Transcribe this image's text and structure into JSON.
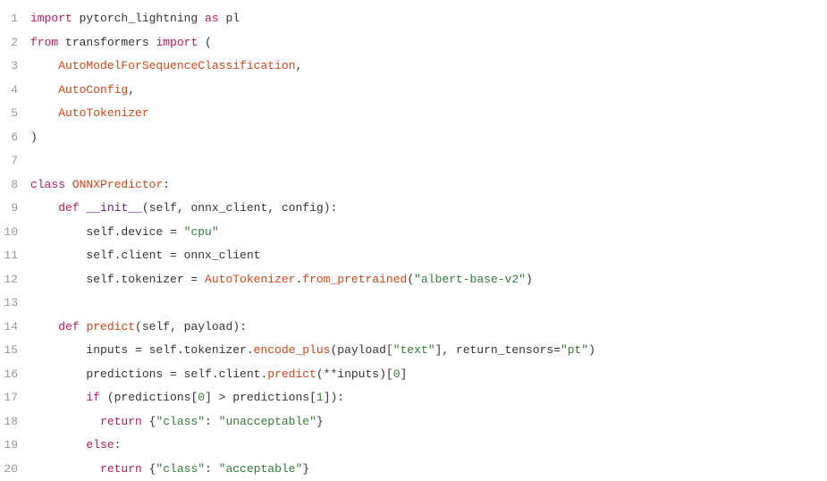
{
  "lines": [
    {
      "num": "1",
      "tokens": [
        {
          "cls": "keyword",
          "text": "import"
        },
        {
          "cls": "",
          "text": " pytorch_lightning "
        },
        {
          "cls": "keyword",
          "text": "as"
        },
        {
          "cls": "",
          "text": " pl"
        }
      ]
    },
    {
      "num": "2",
      "tokens": [
        {
          "cls": "keyword",
          "text": "from"
        },
        {
          "cls": "",
          "text": " transformers "
        },
        {
          "cls": "keyword",
          "text": "import"
        },
        {
          "cls": "",
          "text": " ("
        }
      ]
    },
    {
      "num": "3",
      "tokens": [
        {
          "cls": "",
          "text": "    "
        },
        {
          "cls": "import-name",
          "text": "AutoModelForSequenceClassification"
        },
        {
          "cls": "",
          "text": ","
        }
      ]
    },
    {
      "num": "4",
      "tokens": [
        {
          "cls": "",
          "text": "    "
        },
        {
          "cls": "import-name",
          "text": "AutoConfig"
        },
        {
          "cls": "",
          "text": ","
        }
      ]
    },
    {
      "num": "5",
      "tokens": [
        {
          "cls": "",
          "text": "    "
        },
        {
          "cls": "import-name",
          "text": "AutoTokenizer"
        }
      ]
    },
    {
      "num": "6",
      "tokens": [
        {
          "cls": "",
          "text": ")"
        }
      ]
    },
    {
      "num": "7",
      "tokens": []
    },
    {
      "num": "8",
      "tokens": [
        {
          "cls": "keyword",
          "text": "class"
        },
        {
          "cls": "",
          "text": " "
        },
        {
          "cls": "class-def",
          "text": "ONNXPredictor"
        },
        {
          "cls": "",
          "text": ":"
        }
      ]
    },
    {
      "num": "9",
      "tokens": [
        {
          "cls": "",
          "text": "    "
        },
        {
          "cls": "keyword",
          "text": "def"
        },
        {
          "cls": "",
          "text": " "
        },
        {
          "cls": "dunder",
          "text": "__init__"
        },
        {
          "cls": "",
          "text": "(self, onnx_client, config):"
        }
      ]
    },
    {
      "num": "10",
      "tokens": [
        {
          "cls": "",
          "text": "        self.device = "
        },
        {
          "cls": "string",
          "text": "\"cpu\""
        }
      ]
    },
    {
      "num": "11",
      "tokens": [
        {
          "cls": "",
          "text": "        self.client = onnx_client"
        }
      ]
    },
    {
      "num": "12",
      "tokens": [
        {
          "cls": "",
          "text": "        self.tokenizer = "
        },
        {
          "cls": "method-call",
          "text": "AutoTokenizer"
        },
        {
          "cls": "",
          "text": "."
        },
        {
          "cls": "method-call",
          "text": "from_pretrained"
        },
        {
          "cls": "",
          "text": "("
        },
        {
          "cls": "string",
          "text": "\"albert-base-v2\""
        },
        {
          "cls": "",
          "text": ")"
        }
      ]
    },
    {
      "num": "13",
      "tokens": []
    },
    {
      "num": "14",
      "tokens": [
        {
          "cls": "",
          "text": "    "
        },
        {
          "cls": "keyword",
          "text": "def"
        },
        {
          "cls": "",
          "text": " "
        },
        {
          "cls": "func-def",
          "text": "predict"
        },
        {
          "cls": "",
          "text": "(self, payload):"
        }
      ]
    },
    {
      "num": "15",
      "tokens": [
        {
          "cls": "",
          "text": "        inputs = self.tokenizer."
        },
        {
          "cls": "method-call",
          "text": "encode_plus"
        },
        {
          "cls": "",
          "text": "(payload["
        },
        {
          "cls": "string",
          "text": "\"text\""
        },
        {
          "cls": "",
          "text": "], return_tensors="
        },
        {
          "cls": "string",
          "text": "\"pt\""
        },
        {
          "cls": "",
          "text": ")"
        }
      ]
    },
    {
      "num": "16",
      "tokens": [
        {
          "cls": "",
          "text": "        predictions = self.client."
        },
        {
          "cls": "method-call",
          "text": "predict"
        },
        {
          "cls": "",
          "text": "(**inputs)["
        },
        {
          "cls": "number",
          "text": "0"
        },
        {
          "cls": "",
          "text": "]"
        }
      ]
    },
    {
      "num": "17",
      "tokens": [
        {
          "cls": "",
          "text": "        "
        },
        {
          "cls": "keyword",
          "text": "if"
        },
        {
          "cls": "",
          "text": " (predictions["
        },
        {
          "cls": "number",
          "text": "0"
        },
        {
          "cls": "",
          "text": "] > predictions["
        },
        {
          "cls": "number",
          "text": "1"
        },
        {
          "cls": "",
          "text": "]):"
        }
      ]
    },
    {
      "num": "18",
      "tokens": [
        {
          "cls": "",
          "text": "          "
        },
        {
          "cls": "keyword",
          "text": "return"
        },
        {
          "cls": "",
          "text": " {"
        },
        {
          "cls": "string",
          "text": "\"class\""
        },
        {
          "cls": "",
          "text": ": "
        },
        {
          "cls": "string",
          "text": "\"unacceptable\""
        },
        {
          "cls": "",
          "text": "}"
        }
      ]
    },
    {
      "num": "19",
      "tokens": [
        {
          "cls": "",
          "text": "        "
        },
        {
          "cls": "keyword",
          "text": "else"
        },
        {
          "cls": "",
          "text": ":"
        }
      ]
    },
    {
      "num": "20",
      "tokens": [
        {
          "cls": "",
          "text": "          "
        },
        {
          "cls": "keyword",
          "text": "return"
        },
        {
          "cls": "",
          "text": " {"
        },
        {
          "cls": "string",
          "text": "\"class\""
        },
        {
          "cls": "",
          "text": ": "
        },
        {
          "cls": "string",
          "text": "\"acceptable\""
        },
        {
          "cls": "",
          "text": "}"
        }
      ]
    }
  ]
}
